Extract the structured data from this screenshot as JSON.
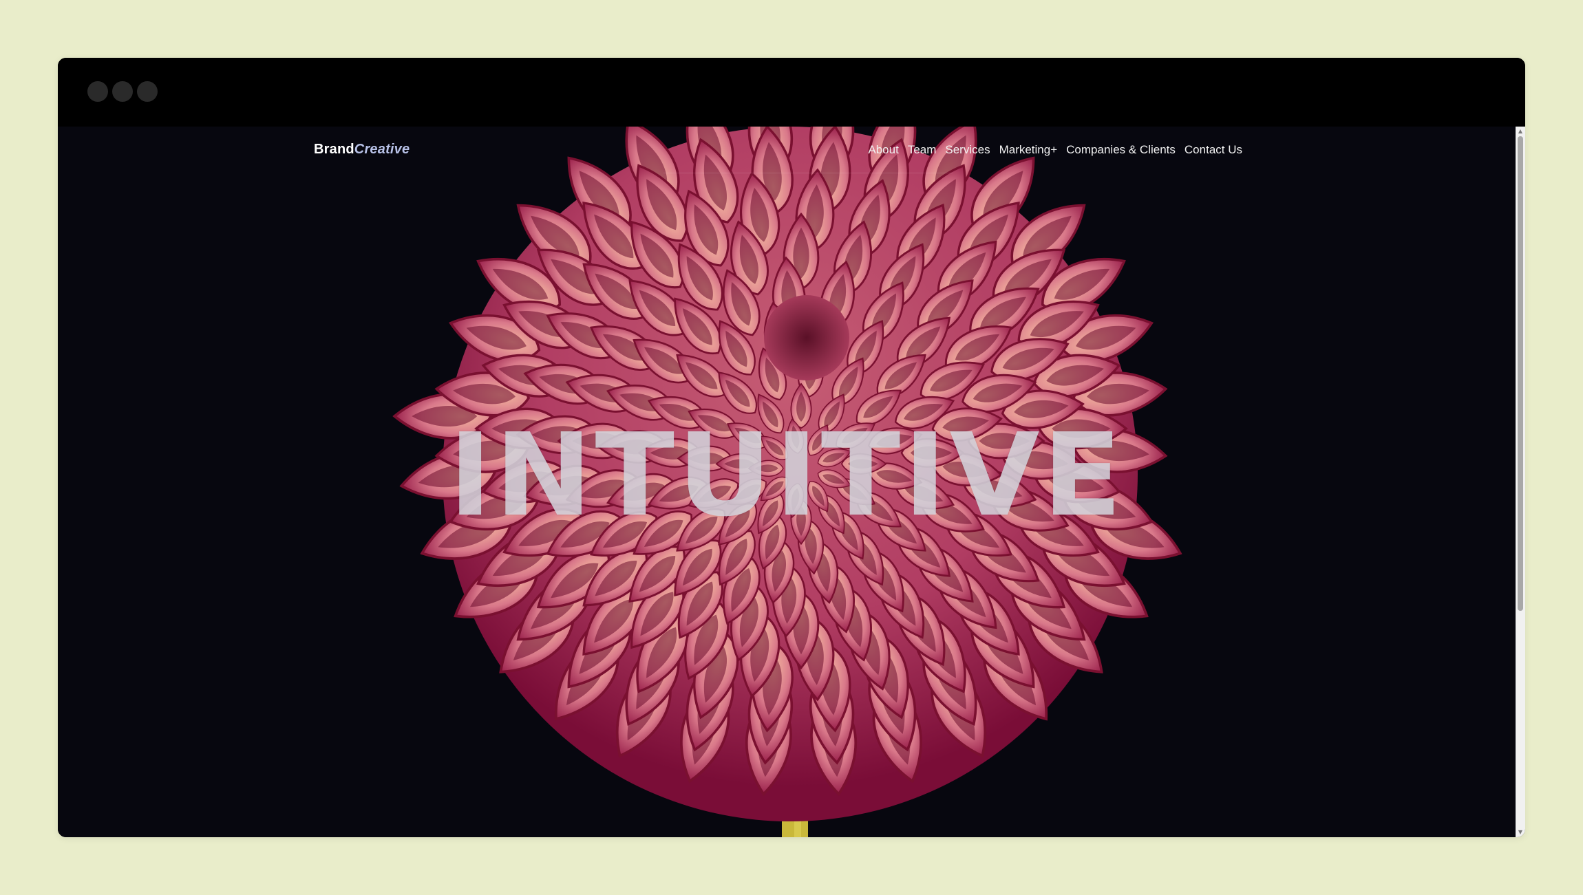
{
  "window": {
    "controls": [
      "close-dot",
      "minimize-dot",
      "maximize-dot"
    ]
  },
  "nav": {
    "brand_main": "Brand",
    "brand_accent": "Creative",
    "links": [
      "About",
      "Team",
      "Services",
      "Marketing+",
      "Companies & Clients",
      "Contact Us"
    ]
  },
  "hero": {
    "headline": "INTUITIVE",
    "image_subject": "pink-dahlia-flower"
  },
  "colors": {
    "page_bg": "#e9edca",
    "window_bg": "#000000",
    "hero_bg": "#07070f",
    "brand_accent": "#b8c2e8",
    "petal_light": "#f0a993",
    "petal_dark": "#a1174a"
  }
}
